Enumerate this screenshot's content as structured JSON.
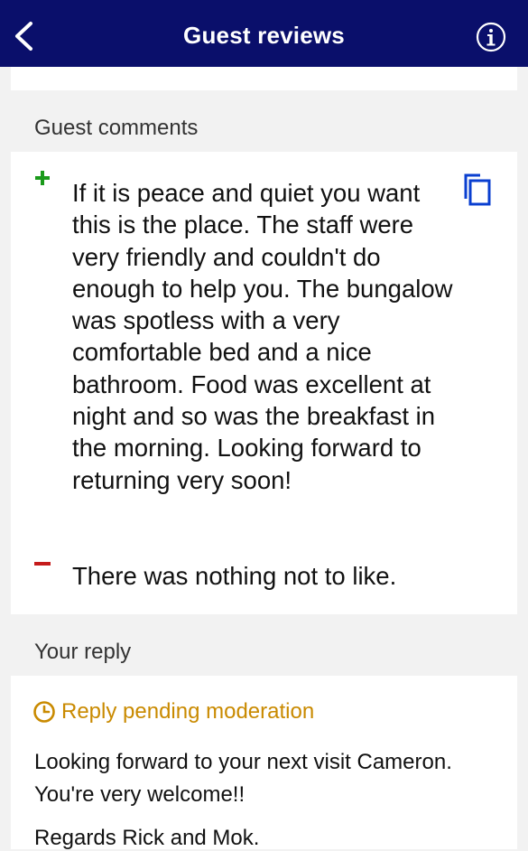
{
  "header": {
    "title": "Guest reviews"
  },
  "icons": {
    "back": "chevron-left-icon",
    "info": "info-circle-icon",
    "copy": "copy-icon",
    "clock": "clock-icon"
  },
  "colors": {
    "header_bg": "#0a0f6b",
    "positive": "#1a9a1a",
    "negative": "#c51b1b",
    "pending": "#c98a00"
  },
  "comments": {
    "label": "Guest comments",
    "positive": "If it is peace and quiet you want this is the place. The staff were very friendly and couldn't do enough to help you. The bungalow was spotless with a very comfortable bed and a nice bathroom. Food was excellent at night and so was the breakfast in the morning. Looking forward to returning very soon!",
    "negative": "There was nothing not to like."
  },
  "reply": {
    "label": "Your reply",
    "status": "Reply pending moderation",
    "line1": "Looking forward to your next visit Cameron.",
    "line2": "You're very welcome!!",
    "line3": "Regards Rick and Mok."
  }
}
